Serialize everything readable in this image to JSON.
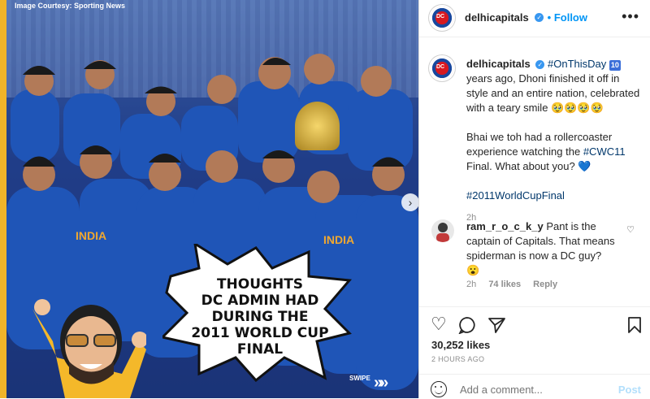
{
  "media": {
    "courtesy": "Image Courtesy: Sporting News",
    "speech_bubble": [
      "THOUGHTS",
      "DC ADMIN HAD",
      "DURING THE",
      "2011 WORLD CUP",
      "FINAL"
    ],
    "jersey_text": "INDIA",
    "swipe_label": "SWIPE",
    "swipe_arrows": "»»",
    "next_arrow": "›"
  },
  "header": {
    "username": "delhicapitals",
    "follow_label": "• Follow",
    "more": "•••"
  },
  "caption": {
    "username": "delhicapitals",
    "hashtag1": "#OnThisDay",
    "number_badge": "10",
    "text1": "years ago, Dhoni finished it off in style and an entire nation, celebrated with a teary smile",
    "emojis": "🥹🥹🥹🥹",
    "text2": "Bhai we toh had a rollercoaster experience watching the",
    "hashtag2": "#CWC11",
    "text3": "Final. What about you?",
    "heart": "💙",
    "hashtag3": "#2011WorldCupFinal",
    "time": "2h"
  },
  "comment": {
    "username": "ram_r_o_c_k_y",
    "text": "Pant is the captain of Capitals. That means spiderman is now a DC guy?",
    "emoji": "😮",
    "time": "2h",
    "likes": "74 likes",
    "reply": "Reply"
  },
  "stats": {
    "likes": "30,252 likes",
    "ago": "2 HOURS AGO"
  },
  "add_comment": {
    "placeholder": "Add a comment...",
    "post_label": "Post"
  },
  "icons": {
    "heart": "♡",
    "comment": "◯",
    "share": "➢",
    "save": "⌑"
  }
}
